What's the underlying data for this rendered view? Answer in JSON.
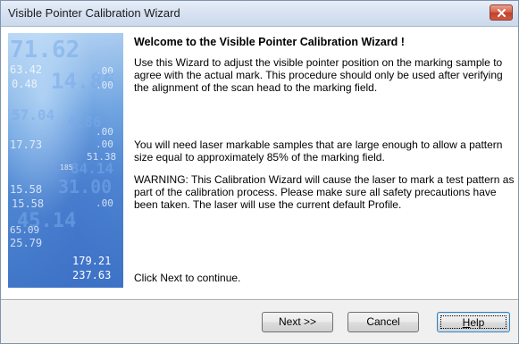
{
  "window": {
    "title": "Visible Pointer Calibration Wizard",
    "close_label": "×"
  },
  "banner": {
    "numbers": [
      "71.62",
      ".00",
      "63.42",
      "14.86",
      "0.48",
      ".00",
      "57.04",
      "4.86",
      "17.73",
      ".00",
      ".00",
      "51.38",
      "185",
      "84.14",
      "15.58",
      "31.00",
      "15.58",
      ".00",
      "45.14",
      "25.79",
      "65.09",
      "179.21",
      "237.63"
    ]
  },
  "content": {
    "heading": "Welcome to the Visible Pointer Calibration Wizard !",
    "para1": "Use this Wizard to adjust the visible pointer position on the marking sample to agree with the actual mark. This procedure should only be used after verifying the alignment of the scan head to the marking field.",
    "para2": "You will need laser markable samples that are large enough to allow a pattern size equal to approximately 85% of the marking field.",
    "para3": "WARNING: This Calibration Wizard will cause the laser to mark a test pattern as part of the calibration process. Please make sure all safety precautions have been taken. The laser will use the current default Profile.",
    "para4": "Click Next to continue."
  },
  "buttons": {
    "next": "Next >>",
    "cancel": "Cancel",
    "help_mnemonic": "H",
    "help_rest": "elp"
  },
  "colors": {
    "close_button": "#c9452f",
    "banner": "#4f86d2",
    "footer": "#f0f0f0"
  }
}
